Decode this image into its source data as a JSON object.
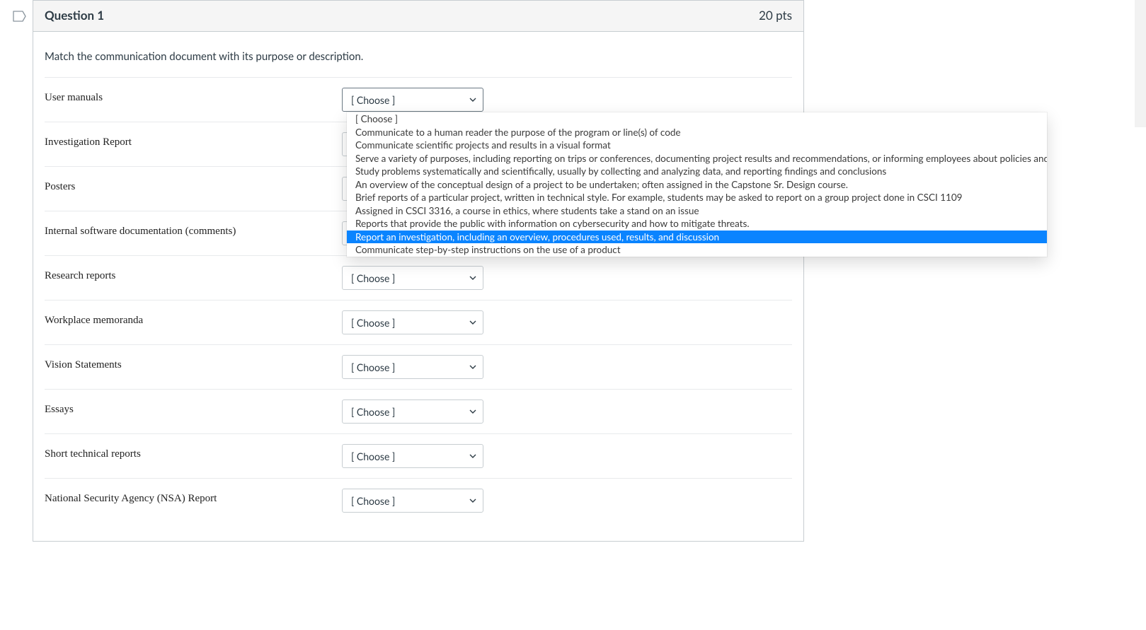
{
  "question": {
    "title": "Question 1",
    "points": "20 pts",
    "prompt": "Match the communication document with its purpose or description.",
    "choose_label": "[ Choose ]",
    "items": [
      {
        "label": "User manuals"
      },
      {
        "label": "Investigation Report"
      },
      {
        "label": "Posters"
      },
      {
        "label": "Internal software documentation (comments)"
      },
      {
        "label": "Research reports"
      },
      {
        "label": "Workplace memoranda"
      },
      {
        "label": "Vision Statements"
      },
      {
        "label": "Essays"
      },
      {
        "label": "Short technical reports"
      },
      {
        "label": "National Security Agency (NSA) Report"
      }
    ]
  },
  "dropdown": {
    "open_for_index": 0,
    "highlighted_index": 9,
    "options": [
      "[ Choose ]",
      "Communicate to a human reader the purpose of the program or line(s) of code",
      "Communicate scientific projects and results in a visual format",
      "Serve a variety of purposes, including reporting on trips or conferences, documenting project results and recommendations, or informing employees about policies and procedu",
      "Study problems systematically and scientifically, usually by collecting and analyzing data, and reporting findings and conclusions",
      "An overview of the conceptual design of a project to be undertaken; often assigned in the Capstone Sr. Design course.",
      "Brief reports of a particular project, written in technical style. For example, students may be asked to report on a group project done in CSCI 1109",
      "Assigned in CSCI 3316, a course in ethics, where students take a stand on an issue",
      "Reports that provide the public with information on cybersecurity and how to mitigate threats.",
      "Report an investigation, including an overview, procedures used, results, and discussion",
      "Communicate step-by-step instructions on the use of a product"
    ]
  }
}
